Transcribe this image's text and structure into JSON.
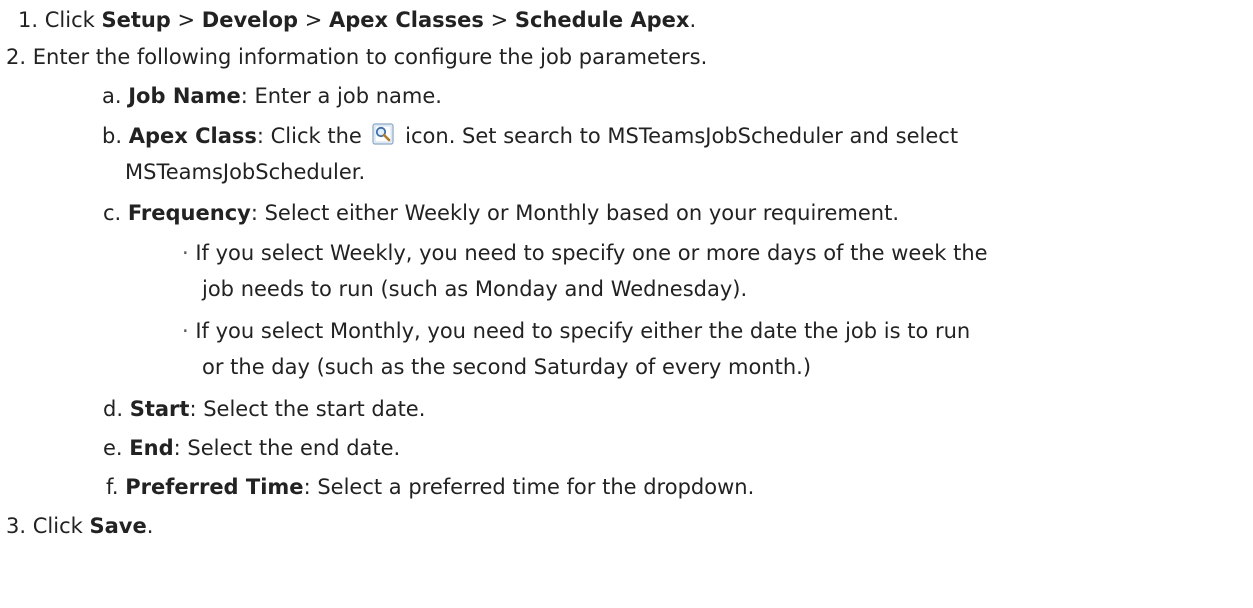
{
  "steps": {
    "s1": {
      "num": "1.",
      "pre": "Click ",
      "setup": "Setup",
      "sep1": " > ",
      "develop": "Develop",
      "sep2": " > ",
      "apex_classes": "Apex Classes",
      "sep3": " > ",
      "schedule_apex": "Schedule Apex",
      "end": "."
    },
    "s2": {
      "num": "2.",
      "text": "Enter the following information to configure the job parameters.",
      "a": {
        "letter": "a.",
        "label": "Job Name",
        "text": ": Enter a job name."
      },
      "b": {
        "letter": "b.",
        "label": "Apex Class",
        "pre": ": Click the",
        "icon": "lookup-magnifier-icon",
        "post": "icon. Set search to MSTeamsJobScheduler and select",
        "cont": "MSTeamsJobScheduler."
      },
      "c": {
        "letter": "c.",
        "label": "Frequency",
        "text": ": Select either Weekly or Monthly based on your requirement.",
        "bullets": [
          {
            "line1": "If you select Weekly, you need to specify one or more days of the week the",
            "line2": "job needs to run (such as Monday and Wednesday)."
          },
          {
            "line1": "If you select Monthly, you need to specify either the date the job is to run",
            "line2": "or the day (such as the second Saturday of every month.)"
          }
        ]
      },
      "d": {
        "letter": "d.",
        "label": "Start",
        "text": ": Select the start date."
      },
      "e": {
        "letter": "e.",
        "label": "End",
        "text": ": Select the end date."
      },
      "f": {
        "letter": "f.",
        "label": "Preferred Time",
        "text": ": Select a preferred time for the dropdown."
      }
    },
    "s3": {
      "num": "3.",
      "pre": "Click ",
      "save": "Save",
      "end": "."
    }
  }
}
